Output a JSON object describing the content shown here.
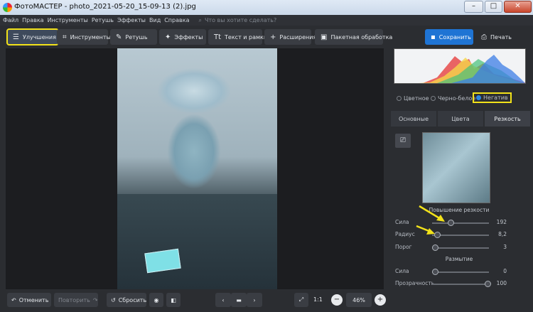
{
  "window": {
    "title": "ФотоМАСТЕР - photo_2021-05-20_15-09-13 (2).jpg",
    "min_icon": "minimize-icon",
    "max_icon": "maximize-icon",
    "close_icon": "close-icon"
  },
  "menu": {
    "items": [
      "Файл",
      "Правка",
      "Инструменты",
      "Ретушь",
      "Эффекты",
      "Вид",
      "Справка"
    ],
    "search_placeholder": "Что вы хотите сделать?"
  },
  "toolbar": {
    "improve": "Улучшения",
    "tools": "Инструменты",
    "retouch": "Ретушь",
    "effects": "Эффекты",
    "text": "Текст и рамки",
    "extensions": "Расширения",
    "batch": "Пакетная обработка",
    "save": "Сохранить",
    "print": "Печать"
  },
  "panel": {
    "modes": [
      "Цветное",
      "Черно-белое",
      "Негатив"
    ],
    "tabs": [
      "Основные",
      "Цвета",
      "Резкость"
    ],
    "sharpen_title": "Повышение резкости",
    "sliders": [
      {
        "label": "Сила",
        "value": "192",
        "level": 0.33
      },
      {
        "label": "Радиус",
        "value": "8,2",
        "level": 0.04
      },
      {
        "label": "Порог",
        "value": "3",
        "level": 0.0
      }
    ],
    "blur_title": "Размытие",
    "blur_sliders": [
      {
        "label": "Сила",
        "value": "0",
        "level": 0.0
      },
      {
        "label": "Прозрачность",
        "value": "100",
        "level": 1.0
      }
    ]
  },
  "bottom": {
    "undo": "Отменить",
    "redo": "Повторить",
    "reset": "Сбросить",
    "ratio": "1:1",
    "zoom": "46%"
  },
  "colors": {
    "accent": "#1f74d4",
    "highlight": "#f2e21a"
  }
}
